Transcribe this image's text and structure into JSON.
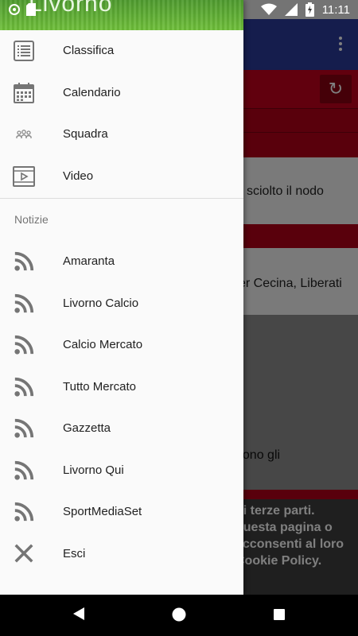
{
  "status_bar": {
    "time": "11:11"
  },
  "drawer": {
    "header_title": "Livorno",
    "items": [
      {
        "label": "Classifica",
        "icon": "list-icon"
      },
      {
        "label": "Calendario",
        "icon": "calendar-icon"
      },
      {
        "label": "Squadra",
        "icon": "team-icon"
      },
      {
        "label": "Video",
        "icon": "video-icon"
      }
    ],
    "section_title": "Notizie",
    "news_items": [
      {
        "label": "Amaranta",
        "icon": "rss-icon"
      },
      {
        "label": "Livorno Calcio",
        "icon": "rss-icon"
      },
      {
        "label": "Calcio Mercato",
        "icon": "rss-icon"
      },
      {
        "label": "Tutto Mercato",
        "icon": "rss-icon"
      },
      {
        "label": "Gazzetta",
        "icon": "rss-icon"
      },
      {
        "label": "Livorno Qui",
        "icon": "rss-icon"
      },
      {
        "label": "SportMediaSet",
        "icon": "rss-icon"
      }
    ],
    "exit_item": {
      "label": "Esci",
      "icon": "close-icon"
    }
  },
  "background": {
    "headline_1": "sciolto il nodo",
    "headline_2": "er Cecina, Liberati",
    "headline_3": "dono gli",
    "cookie_lines": [
      "di terze parti.",
      "questa pagina o",
      "acconsenti al loro",
      "Cookie Policy."
    ]
  },
  "colors": {
    "toolbar": "#2b3a9a",
    "accent_red": "#c2001c",
    "drawer_bg": "#fafafa"
  }
}
